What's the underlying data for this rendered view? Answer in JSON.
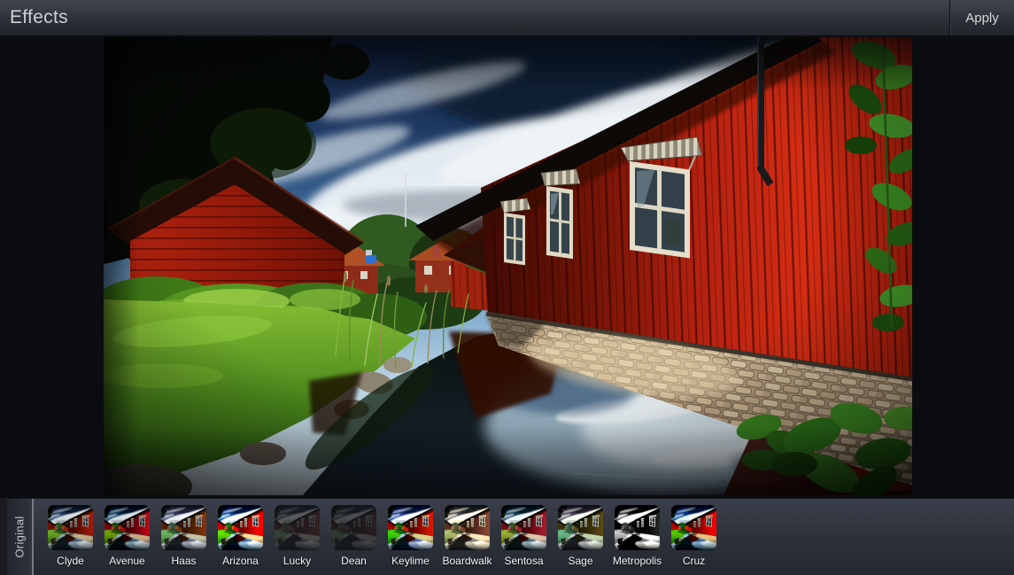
{
  "header": {
    "title": "Effects",
    "apply_label": "Apply"
  },
  "original_tab": {
    "label": "Original"
  },
  "filters": [
    {
      "id": "clyde",
      "label": "Clyde"
    },
    {
      "id": "avenue",
      "label": "Avenue"
    },
    {
      "id": "haas",
      "label": "Haas"
    },
    {
      "id": "arizona",
      "label": "Arizona"
    },
    {
      "id": "lucky",
      "label": "Lucky"
    },
    {
      "id": "dean",
      "label": "Dean"
    },
    {
      "id": "keylime",
      "label": "Keylime"
    },
    {
      "id": "boardwalk",
      "label": "Boardwalk"
    },
    {
      "id": "sentosa",
      "label": "Sentosa"
    },
    {
      "id": "sage",
      "label": "Sage"
    },
    {
      "id": "metropolis",
      "label": "Metropolis"
    },
    {
      "id": "cruz",
      "label": "Cruz"
    }
  ],
  "photo": {
    "alt": "HDR photo of red wooden houses beside a reflective canal under a dramatic cloudy blue sky"
  },
  "colors": {
    "actionbar_bg": "#33383f",
    "filmstrip_bg": "#2e333d",
    "stage_bg": "#0b0c10",
    "barn_red": "#c02410",
    "label_text": "#f1f2f3"
  }
}
